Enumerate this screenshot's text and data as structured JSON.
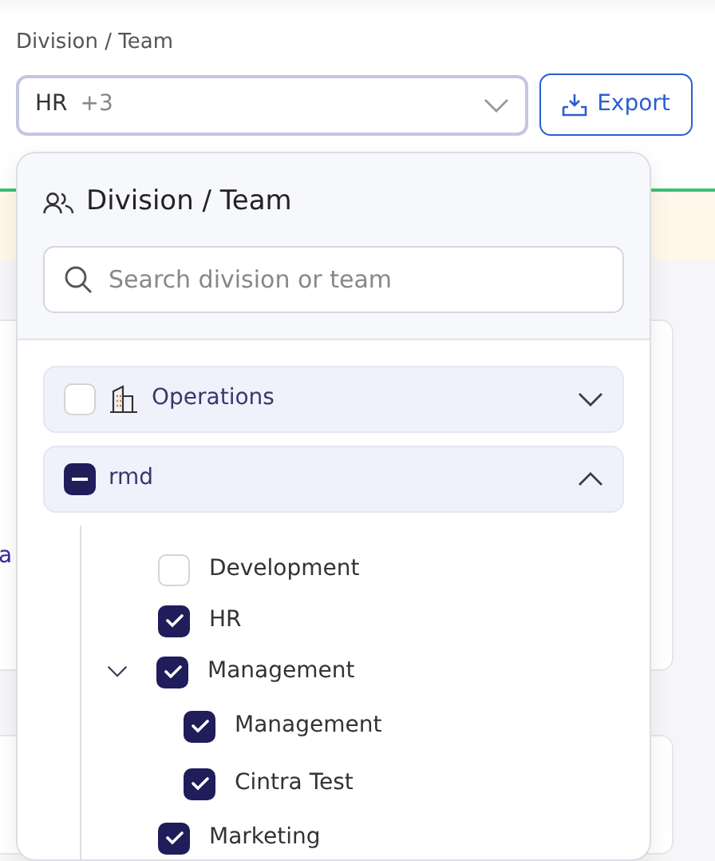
{
  "filter": {
    "label": "Division / Team",
    "select": {
      "value": "HR",
      "more": "+3"
    },
    "export_button": "Export"
  },
  "background": {
    "link_fragment": "a"
  },
  "dropdown": {
    "title": "Division / Team",
    "search": {
      "placeholder": "Search division or team"
    },
    "divisions": [
      {
        "name": "Operations",
        "kind": "building",
        "checked": false,
        "expanded": false
      },
      {
        "name": "rmd",
        "kind": "plain",
        "checked": true,
        "partial": true,
        "expanded": true,
        "teams": [
          {
            "name": "Development",
            "checked": false
          },
          {
            "name": "HR",
            "checked": true
          },
          {
            "name": "Management",
            "checked": true,
            "expanded": true,
            "children": [
              {
                "name": "Management",
                "checked": true
              },
              {
                "name": "Cintra Test",
                "checked": true
              }
            ]
          },
          {
            "name": "Marketing",
            "checked": true
          }
        ]
      }
    ]
  }
}
